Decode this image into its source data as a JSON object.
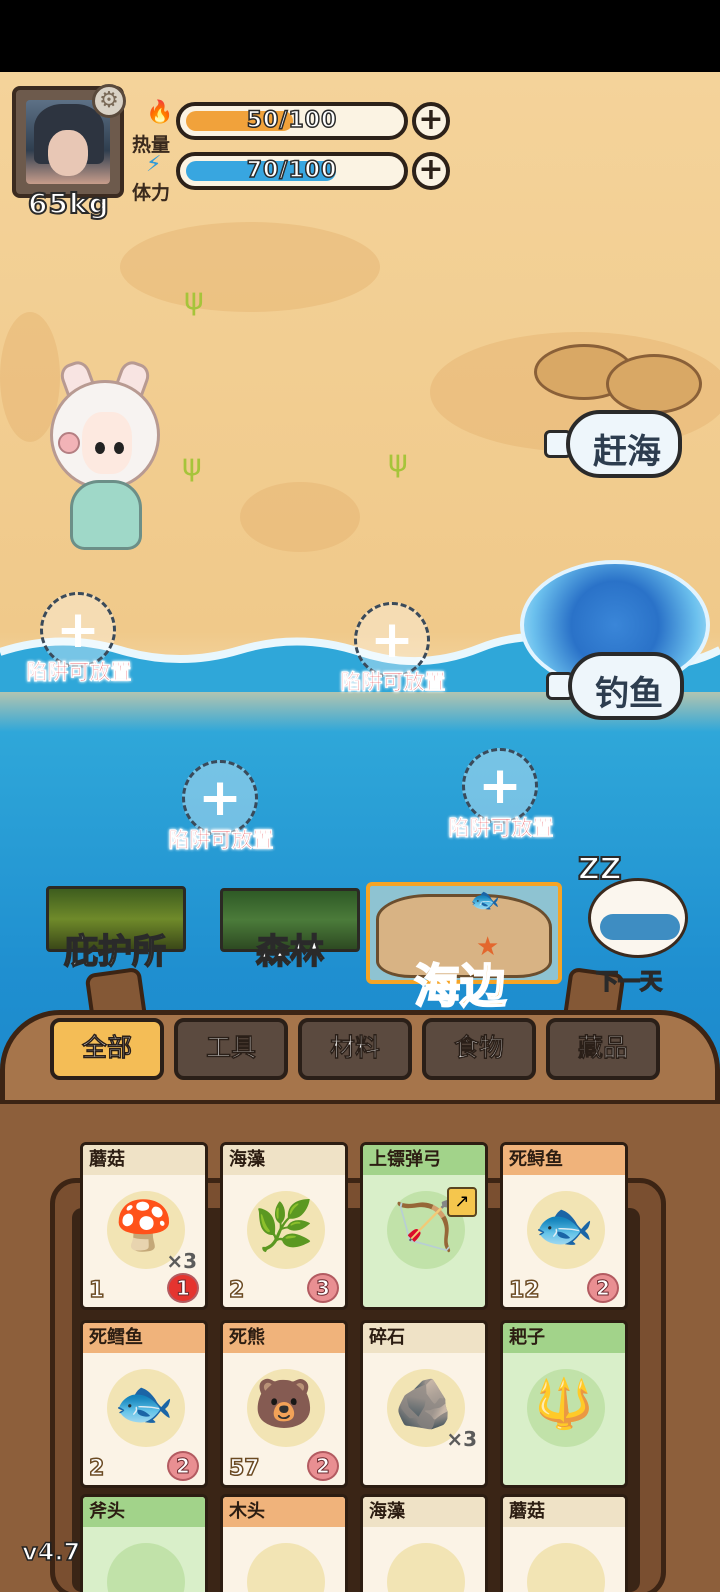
{
  "hud": {
    "weight": "65kg",
    "heat": {
      "label": "热量",
      "value": "50/100",
      "fraction": 0.5,
      "color": "#f1a23b"
    },
    "stamina": {
      "label": "体力",
      "value": "70/100",
      "fraction": 0.7,
      "color": "#38a6e0"
    },
    "plus": "+"
  },
  "actions": {
    "beachcomb": "赶海",
    "fishing": "钓鱼"
  },
  "traps": [
    {
      "plus": "+",
      "label": "陷阱可放置"
    },
    {
      "plus": "+",
      "label": "陷阱可放置"
    },
    {
      "plus": "+",
      "label": "陷阱可放置"
    },
    {
      "plus": "+",
      "label": "陷阱可放置"
    }
  ],
  "locations": {
    "shelter": "庇护所",
    "forest": "森林",
    "beach": "海边",
    "next_day": "下一天",
    "sleep_icon": "ZZ"
  },
  "tabs": [
    "全部",
    "工具",
    "材料",
    "食物",
    "藏品"
  ],
  "items": [
    {
      "name": "蘑菇",
      "icon": "🍄",
      "qty": "×3",
      "weight": "1",
      "count": "1",
      "type": "food"
    },
    {
      "name": "海藻",
      "icon": "🌿",
      "qty": "",
      "weight": "2",
      "count": "3",
      "type": "food"
    },
    {
      "name": "上镖弹弓",
      "icon": "🏹",
      "qty": "",
      "weight": "",
      "count": "",
      "type": "tool"
    },
    {
      "name": "死鲟鱼",
      "icon": "🐟",
      "qty": "",
      "weight": "12",
      "count": "2",
      "type": "catch"
    },
    {
      "name": "死鳕鱼",
      "icon": "🐟",
      "qty": "",
      "weight": "2",
      "count": "2",
      "type": "catch"
    },
    {
      "name": "死熊",
      "icon": "🐻",
      "qty": "",
      "weight": "57",
      "count": "2",
      "type": "catch"
    },
    {
      "name": "碎石",
      "icon": "🪨",
      "qty": "×3",
      "weight": "",
      "count": "",
      "type": "material"
    },
    {
      "name": "耙子",
      "icon": "🔱",
      "qty": "",
      "weight": "",
      "count": "",
      "type": "tool"
    },
    {
      "name": "斧头",
      "icon": "",
      "qty": "",
      "weight": "",
      "count": "",
      "type": "tool"
    },
    {
      "name": "木头",
      "icon": "",
      "qty": "",
      "weight": "",
      "count": "",
      "type": "catch"
    },
    {
      "name": "海藻",
      "icon": "",
      "qty": "",
      "weight": "",
      "count": "",
      "type": "food"
    },
    {
      "name": "蘑菇",
      "icon": "",
      "qty": "",
      "weight": "",
      "count": "",
      "type": "food"
    }
  ],
  "version": "v4.7"
}
